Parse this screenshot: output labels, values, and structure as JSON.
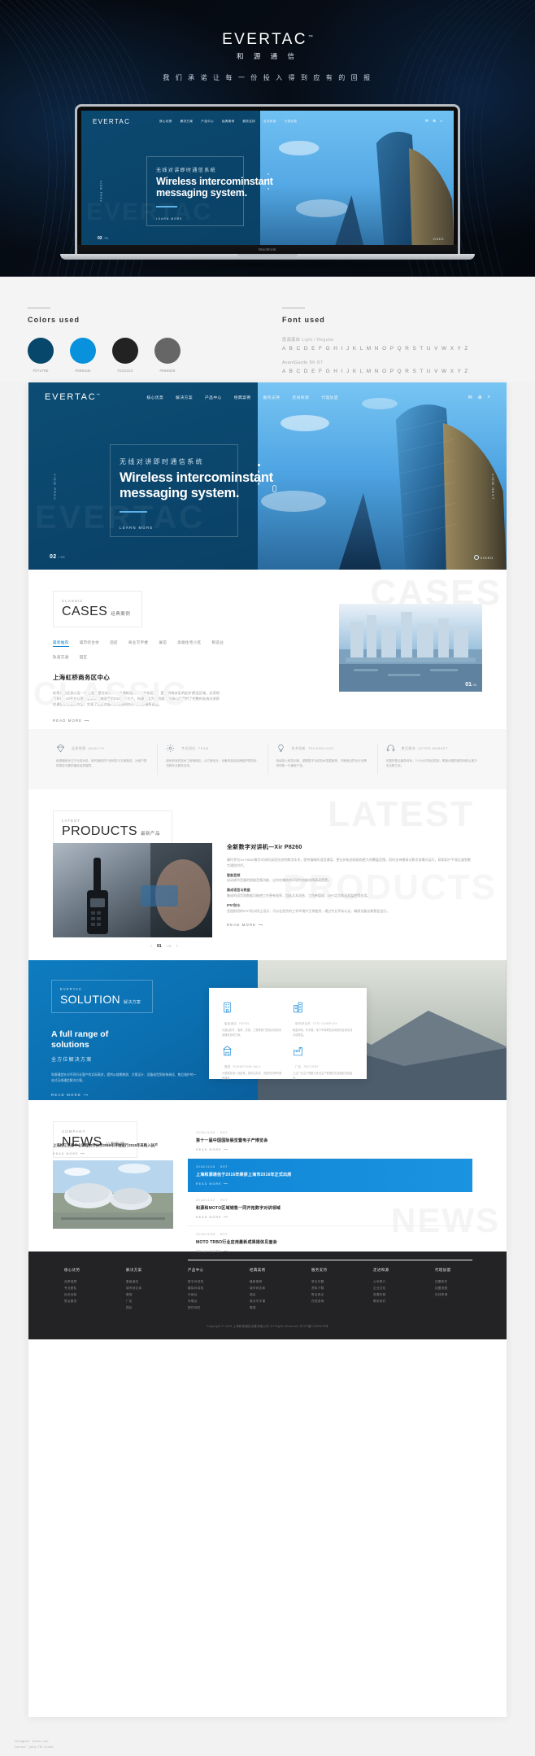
{
  "brand": {
    "name": "EVERTAC",
    "tm": "™",
    "name_cn": "和 源 通 信",
    "slogan": "我 们 承 诺  让 每 一 份 投 入  得 到 应 有 的 回 报"
  },
  "macbook": {
    "label": "MacBook"
  },
  "specs": {
    "colors_title": "Colors used",
    "font_title": "Font used",
    "swatches": [
      {
        "hex": "#07476b",
        "label": "#07476b"
      },
      {
        "hex": "#0892de",
        "label": "#0892de"
      },
      {
        "hex": "#222222",
        "label": "#222222"
      },
      {
        "hex": "#666666",
        "label": "#666666"
      }
    ],
    "fonts": [
      {
        "name": "思源黑体",
        "weights": "Light / Regular",
        "abc": "A B C D E F G H I J K L M N O P Q R S T U V W X Y Z"
      },
      {
        "name": "AvantGarde",
        "weights": "BK   BT",
        "abc": "A B C D E F G H I J K L M N O P Q R S T U V W X Y Z"
      }
    ]
  },
  "site": {
    "nav": [
      "核心优势",
      "解决方案",
      "产品中心",
      "经典案例",
      "服务支持",
      "走进和源",
      "代理加盟"
    ],
    "nav_icons": [
      "chat-icon",
      "globe-icon",
      "search-icon"
    ],
    "hero": {
      "cn": "无线对讲即时通信系统",
      "en_line1": "Wireless intercominstant",
      "en_line2": "messaging system.",
      "learn_more": "LEARN MORE",
      "view_prev": "VIEW PREV",
      "view_next": "VIEW NEXT",
      "ghost": "EVERTAC",
      "page_num": "02",
      "page_total": "/ 03",
      "video": "VIDEO"
    },
    "cases": {
      "kicker": "CLASSIC",
      "title": "CASES",
      "title_cn": "经典案例",
      "ghost": "CASES",
      "ghost_left": "CLASSIC",
      "tabs": [
        "最新推荐",
        "城市综合体",
        "酒店",
        "商业写字楼",
        "展馆",
        "高端住宅小区",
        "制造业",
        "轨道交通",
        "园区"
      ],
      "active_tab": "最新推荐",
      "headline": "上海虹桥商务区中心",
      "body": "虹桥商务区核心区一期工程，是在虹桥综合交通枢纽的西侧商务区内，是虹桥商务区的起步建设区域。总用地面积约1.43平方公里，规划总建筑面积约210万平方米。和源通信为虹桥商务区核心区提供了完整的无线对讲即时通信系统解决方案，实现了园区内部的高效协同办公与应急指挥调度。",
      "read_more": "READ MORE",
      "img_num": "01",
      "img_total": "/ 06"
    },
    "features": [
      {
        "icon": "diamond-icon",
        "title": "品质保障",
        "title_en": "QUALITY",
        "body": "和源通信专注于无线对讲、即时通信的产品研发与方案集成，为客户提供稳定可靠的通信品质保障。"
      },
      {
        "icon": "gear-icon",
        "title": "专业团队",
        "title_en": "TEAM",
        "body": "拥有资深的技术工程师团队，从方案设计、设备安装到后期维护提供全流程专业服务支持。"
      },
      {
        "icon": "bulb-icon",
        "title": "技术创新",
        "title_en": "TECHNOLOGY",
        "body": "持续投入研发创新，紧跟数字对讲技术发展趋势，不断推出符合行业需求的新一代通信产品。"
      },
      {
        "icon": "headset-icon",
        "title": "售后服务",
        "title_en": "AFTER-MARKET",
        "body": "完善的售后服务体系，7×24小时响应机制，覆盖全国的服务网络让客户无后顾之忧。"
      }
    ],
    "products": {
      "kicker": "LATEST",
      "title": "PRODUCTS",
      "title_cn": "最新产品",
      "ghost": "LATEST",
      "ghost2": "PRODUCTS",
      "headline": "全新数字对讲机—Xir P8260",
      "body": "摩托罗拉Xir P8260数字对讲机采用先进的数字技术，提供清晰的语音通话、更长的电池续航和更大的覆盖范围，同时支持模拟与数字双模式运行，帮助用户平滑过渡到数字通信时代。",
      "spec_title_1": "智能音频",
      "spec_1": "自动调节音量的智能音频功能，让你在嘈杂的环境中也能听得清清楚楚。",
      "spec_title_2": "集成语音与数据",
      "spec_2": "集成的语音和数据功能使工作更有效率，包括文本消息、工作单管理、GPS定位和远程监控等应用。",
      "spec_title_3": "IP57防水",
      "spec_3": "坚固耐用的IP57防水防尘设计，可以在恶劣的工作环境中正常使用，通过专业军标认证，确保设备长期稳定运行。",
      "read_more": "READ MORE",
      "page_num": "01",
      "page_total": "/ 09"
    },
    "solution": {
      "kicker": "EVERTAC",
      "title": "SOLUTION",
      "title_cn": "解决方案",
      "headline_en_1": "A full range of",
      "headline_en_2": "solutions",
      "headline_cn": "全方位解决方案",
      "body": "和源通信针对不同行业客户的实际需求，提供从前期勘测、方案设计、设备选型到安装调试、售后维护的一站式无线通信解决方案。",
      "read_more": "READ MORE",
      "cards": [
        {
          "icon": "hotel-icon",
          "title": "星级酒店",
          "title_en": "HOTEL",
          "body": "为酒店前厅、客房、安保、工程等部门提供高效的内部通信协同方案。"
        },
        {
          "icon": "city-icon",
          "title": "城市综合体",
          "title_en": "CITY COMPLEX",
          "body": "覆盖商场、写字楼、地下车库等复杂场景的全域无线对讲覆盖。"
        },
        {
          "icon": "hall-icon",
          "title": "展馆",
          "title_en": "EXHIBITION HALL",
          "body": "大型展览馆人流密集，提供高并发、低延时的即时调度通信。"
        },
        {
          "icon": "factory-icon",
          "title": "厂区",
          "title_en": "FACTORY",
          "body": "工业厂区生产调度与安全生产管理的无线通信系统建设。"
        }
      ]
    },
    "news": {
      "kicker": "COMPANY",
      "title": "NEWS",
      "title_cn": "公司新闻",
      "ghost": "NEWS",
      "headline_left": "上海松江名泰中心课程合作伙伴2016年开始运行2015年采购入驻产",
      "read_more_left": "READ MORE",
      "items": [
        {
          "date": "2016/11/20",
          "tag": "HOT",
          "title": "第十一届中国国际展览暨电子产博览会",
          "more": "READ MORE",
          "highlight": false
        },
        {
          "date": "2016/11/18",
          "tag": "HOT",
          "title": "上海和源通信于2016年荣获上海市2016年正式出席",
          "more": "READ MORE",
          "highlight": true
        },
        {
          "date": "2016/11/12",
          "tag": "HOT",
          "title": "和源和MOTO区域销售一同开拓数字对讲领域",
          "more": "READ MORE",
          "highlight": false
        },
        {
          "date": "2016/11/08",
          "tag": "HOT",
          "title": "MOTO TRBO行业应用最新成果媒体见面会",
          "more": "READ MORE",
          "highlight": false
        }
      ]
    },
    "footer": {
      "columns": [
        {
          "head": "核心优势",
          "links": [
            "品质保障",
            "专业团队",
            "技术创新",
            "售后服务"
          ]
        },
        {
          "head": "解决方案",
          "links": [
            "星级酒店",
            "城市综合体",
            "展馆",
            "厂区",
            "园区"
          ]
        },
        {
          "head": "产品中心",
          "links": [
            "数字对讲机",
            "模拟对讲机",
            "中继台",
            "车载台",
            "配件耳机"
          ]
        },
        {
          "head": "经典案例",
          "links": [
            "最新推荐",
            "城市综合体",
            "酒店",
            "商业写字楼",
            "展馆"
          ]
        },
        {
          "head": "服务支持",
          "links": [
            "常见问题",
            "资料下载",
            "售后网点",
            "在线咨询"
          ]
        },
        {
          "head": "走进和源",
          "links": [
            "公司简介",
            "企业文化",
            "发展历程",
            "联系我们"
          ]
        },
        {
          "head": "代理加盟",
          "links": [
            "加盟条件",
            "加盟流程",
            "在线申请"
          ]
        }
      ],
      "copyright": "Copyright © 2016 上海和源通信设备有限公司 All Rights Reserved   沪ICP备12345678号"
    }
  },
  "credits": {
    "line1": "Designer：Dave Lam",
    "line2": "Device：jump TM Credit"
  }
}
